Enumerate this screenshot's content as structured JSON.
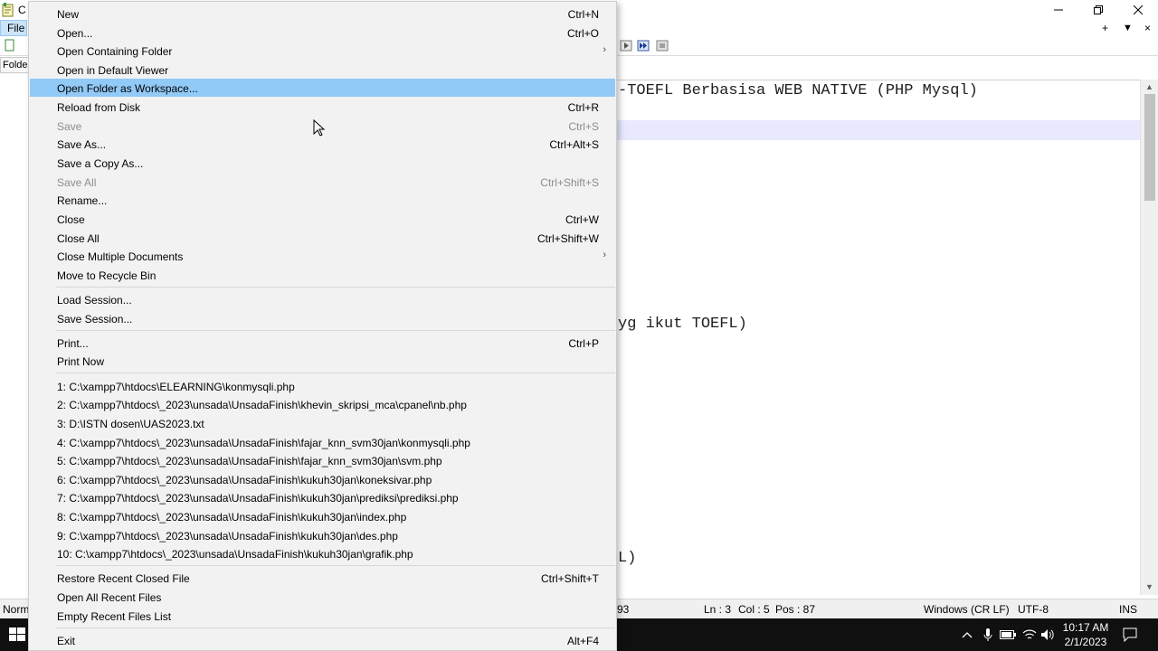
{
  "window": {
    "title_fragment": "C",
    "file_menu_label": "File",
    "folder_panel_label": "Folder",
    "tab_add": "+",
    "tab_list": "▼",
    "tab_close": "×"
  },
  "editor_lines": [
    "-TOEFL Berbasisa WEB NATIVE (PHP Mysql)",
    "yg ikut TOEFL)",
    "L)"
  ],
  "statusbar": {
    "mode_fragment": "Norm",
    "length_fragment": "93",
    "line": "Ln : 3",
    "col": "Col : 5",
    "pos": "Pos : 87",
    "eol": "Windows (CR LF)",
    "encoding": "UTF-8",
    "ins": "INS"
  },
  "taskbar": {
    "time": "10:17 AM",
    "date": "2/1/2023"
  },
  "menu": {
    "items": [
      {
        "label": "New",
        "shortcut": "Ctrl+N"
      },
      {
        "label": "Open...",
        "shortcut": "Ctrl+O"
      },
      {
        "label": "Open Containing Folder",
        "shortcut": "",
        "submenu": true
      },
      {
        "label": "Open in Default Viewer",
        "shortcut": ""
      },
      {
        "label": "Open Folder as Workspace...",
        "shortcut": "",
        "highlighted": true
      },
      {
        "label": "Reload from Disk",
        "shortcut": "Ctrl+R"
      },
      {
        "label": "Save",
        "shortcut": "Ctrl+S",
        "disabled": true
      },
      {
        "label": "Save As...",
        "shortcut": "Ctrl+Alt+S"
      },
      {
        "label": "Save a Copy As...",
        "shortcut": ""
      },
      {
        "label": "Save All",
        "shortcut": "Ctrl+Shift+S",
        "disabled": true
      },
      {
        "label": "Rename...",
        "shortcut": ""
      },
      {
        "label": "Close",
        "shortcut": "Ctrl+W"
      },
      {
        "label": "Close All",
        "shortcut": "Ctrl+Shift+W"
      },
      {
        "label": "Close Multiple Documents",
        "shortcut": "",
        "submenu": true
      },
      {
        "label": "Move to Recycle Bin",
        "shortcut": ""
      },
      {
        "label": "Load Session...",
        "shortcut": ""
      },
      {
        "label": "Save Session...",
        "shortcut": ""
      },
      {
        "label": "Print...",
        "shortcut": "Ctrl+P"
      },
      {
        "label": "Print Now",
        "shortcut": ""
      },
      {
        "label": "1: C:\\xampp7\\htdocs\\ELEARNING\\konmysqli.php",
        "shortcut": ""
      },
      {
        "label": "2: C:\\xampp7\\htdocs\\_2023\\unsada\\UnsadaFinish\\khevin_skripsi_mca\\cpanel\\nb.php",
        "shortcut": ""
      },
      {
        "label": "3: D:\\ISTN dosen\\UAS2023.txt",
        "shortcut": ""
      },
      {
        "label": "4: C:\\xampp7\\htdocs\\_2023\\unsada\\UnsadaFinish\\fajar_knn_svm30jan\\konmysqli.php",
        "shortcut": ""
      },
      {
        "label": "5: C:\\xampp7\\htdocs\\_2023\\unsada\\UnsadaFinish\\fajar_knn_svm30jan\\svm.php",
        "shortcut": ""
      },
      {
        "label": "6: C:\\xampp7\\htdocs\\_2023\\unsada\\UnsadaFinish\\kukuh30jan\\koneksivar.php",
        "shortcut": ""
      },
      {
        "label": "7: C:\\xampp7\\htdocs\\_2023\\unsada\\UnsadaFinish\\kukuh30jan\\prediksi\\prediksi.php",
        "shortcut": ""
      },
      {
        "label": "8: C:\\xampp7\\htdocs\\_2023\\unsada\\UnsadaFinish\\kukuh30jan\\index.php",
        "shortcut": ""
      },
      {
        "label": "9: C:\\xampp7\\htdocs\\_2023\\unsada\\UnsadaFinish\\kukuh30jan\\des.php",
        "shortcut": ""
      },
      {
        "label": "10: C:\\xampp7\\htdocs\\_2023\\unsada\\UnsadaFinish\\kukuh30jan\\grafik.php",
        "shortcut": ""
      },
      {
        "label": "Restore Recent Closed File",
        "shortcut": "Ctrl+Shift+T"
      },
      {
        "label": "Open All Recent Files",
        "shortcut": ""
      },
      {
        "label": "Empty Recent Files List",
        "shortcut": ""
      },
      {
        "label": "Exit",
        "shortcut": "Alt+F4"
      }
    ]
  }
}
